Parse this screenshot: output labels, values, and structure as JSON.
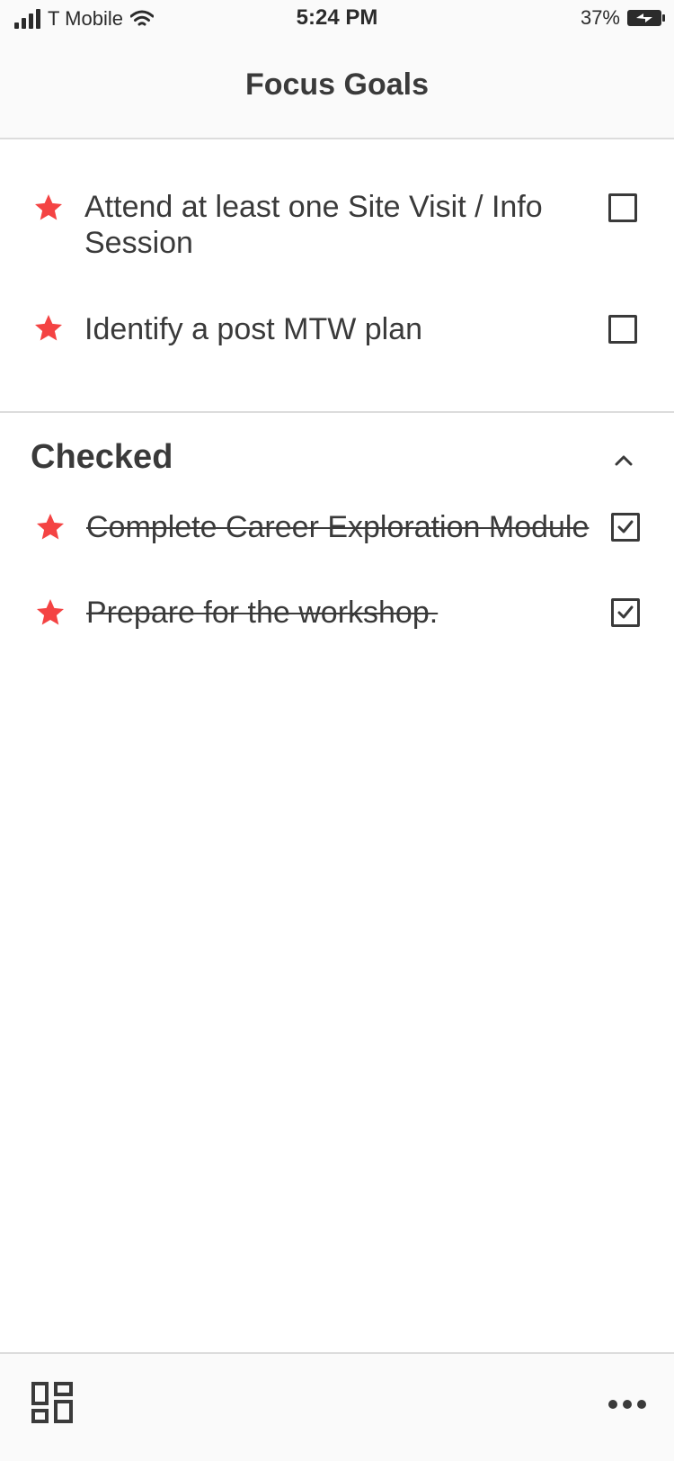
{
  "status": {
    "carrier": "T Mobile",
    "time": "5:24 PM",
    "battery": "37%"
  },
  "header": {
    "title": "Focus Goals"
  },
  "goals": [
    {
      "text": "Attend at least one Site Visit / Info Session",
      "starred": true,
      "checked": false
    },
    {
      "text": "Identify a post MTW plan",
      "starred": true,
      "checked": false
    }
  ],
  "checked_section": {
    "title": "Checked",
    "expanded": true,
    "items": [
      {
        "text": "Complete Career Exploration Module",
        "starred": true,
        "checked": true
      },
      {
        "text": "Prepare for the workshop.",
        "starred": true,
        "checked": true
      }
    ]
  },
  "bottom_bar": {
    "left_icon": "dashboard-icon",
    "right_icon": "more-icon"
  },
  "colors": {
    "star": "#f44343",
    "text": "#3a3a3a",
    "bar_bg": "#fafafa",
    "divider": "#dcdcdc"
  }
}
